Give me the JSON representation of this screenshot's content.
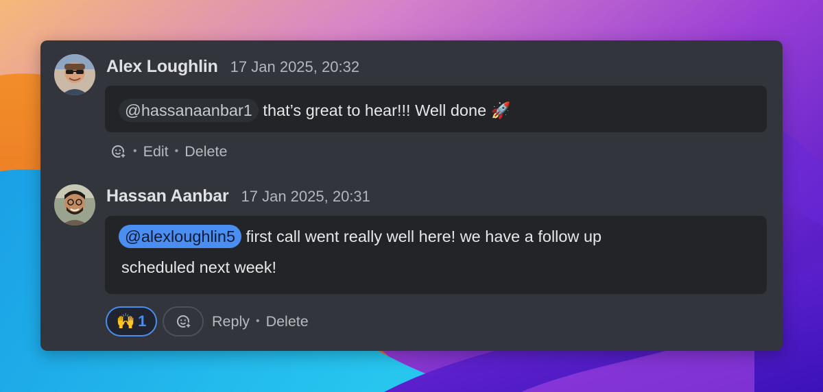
{
  "theme": {
    "panel_bg": "#32353b",
    "bubble_bg": "#222427",
    "accent": "#4a8ef2"
  },
  "comments": [
    {
      "author": "Alex Loughlin",
      "timestamp": "17 Jan 2025, 20:32",
      "mention": "@hassanaanbar1",
      "text": "that’s great to hear!!! Well done",
      "emoji": "🚀",
      "actions": {
        "edit": "Edit",
        "delete": "Delete"
      },
      "icons": [
        "add-reaction-icon"
      ]
    },
    {
      "author": "Hassan Aanbar",
      "timestamp": "17 Jan 2025, 20:31",
      "mention": "@alexloughlin5",
      "text_line1": "first call went really well here! we have a follow up",
      "text_line2": "scheduled next week!",
      "reaction": {
        "emoji": "🙌",
        "count": "1"
      },
      "actions": {
        "reply": "Reply",
        "delete": "Delete"
      },
      "icons": [
        "add-reaction-icon"
      ]
    }
  ],
  "separator": "•"
}
